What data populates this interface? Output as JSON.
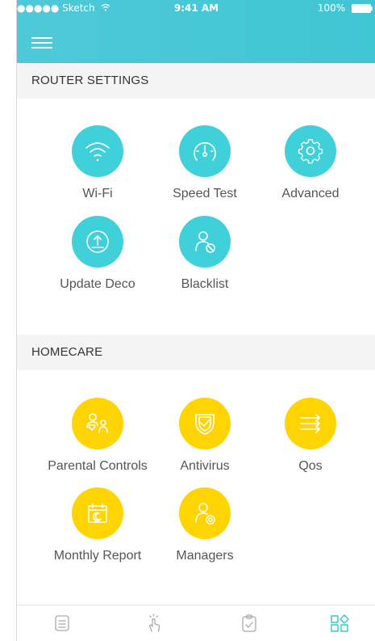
{
  "status_bar": {
    "carrier": "●●●●● Sketch",
    "time": "9:41 AM",
    "battery": "100%"
  },
  "sections": {
    "router_settings": {
      "title": "ROUTER SETTINGS",
      "items": [
        {
          "label": "Wi-Fi",
          "icon": "wifi-icon"
        },
        {
          "label": "Speed Test",
          "icon": "speedometer-icon"
        },
        {
          "label": "Advanced",
          "icon": "gear-icon"
        },
        {
          "label": "Update Deco",
          "icon": "upload-icon"
        },
        {
          "label": "Blacklist",
          "icon": "blocked-user-icon"
        }
      ]
    },
    "homecare": {
      "title": "HOMECARE",
      "items": [
        {
          "label": "Parental Controls",
          "icon": "family-icon"
        },
        {
          "label": "Antivirus",
          "icon": "shield-icon"
        },
        {
          "label": "Qos",
          "icon": "arrows-icon"
        },
        {
          "label": "Monthly Report",
          "icon": "calendar-icon"
        },
        {
          "label": "Managers",
          "icon": "user-settings-icon"
        }
      ]
    }
  },
  "tabbar": {
    "tabs": [
      {
        "icon": "list-icon",
        "active": false
      },
      {
        "icon": "tap-icon",
        "active": false
      },
      {
        "icon": "clipboard-check-icon",
        "active": false
      },
      {
        "icon": "apps-grid-icon",
        "active": true
      }
    ]
  },
  "colors": {
    "header": "#45c8d6",
    "teal_accent": "#3fd0d9",
    "yellow_accent": "#ffd400",
    "section_bg": "#f4f4f4"
  }
}
